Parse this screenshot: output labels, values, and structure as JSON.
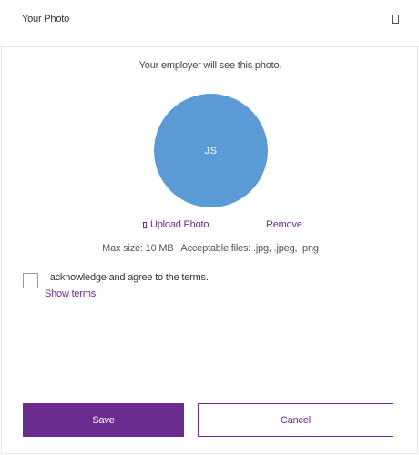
{
  "dialog": {
    "title": "Your Photo",
    "close_icon": "close-icon"
  },
  "photo": {
    "intro_text": "Your employer will see this photo.",
    "initials": "JS",
    "avatar_color": "#5b9bd5",
    "upload_label": "Upload Photo",
    "upload_icon": "upload-icon",
    "remove_label": "Remove",
    "file_info": "Max size: 10 MB   Acceptable files: .jpg, .jpeg, .png"
  },
  "terms": {
    "checked": false,
    "acknowledge_label": "I acknowledge and agree to the terms.",
    "show_terms_label": "Show terms"
  },
  "footer": {
    "save_label": "Save",
    "cancel_label": "Cancel"
  },
  "colors": {
    "accent": "#6b2c8f",
    "border": "#e6e6e6"
  }
}
